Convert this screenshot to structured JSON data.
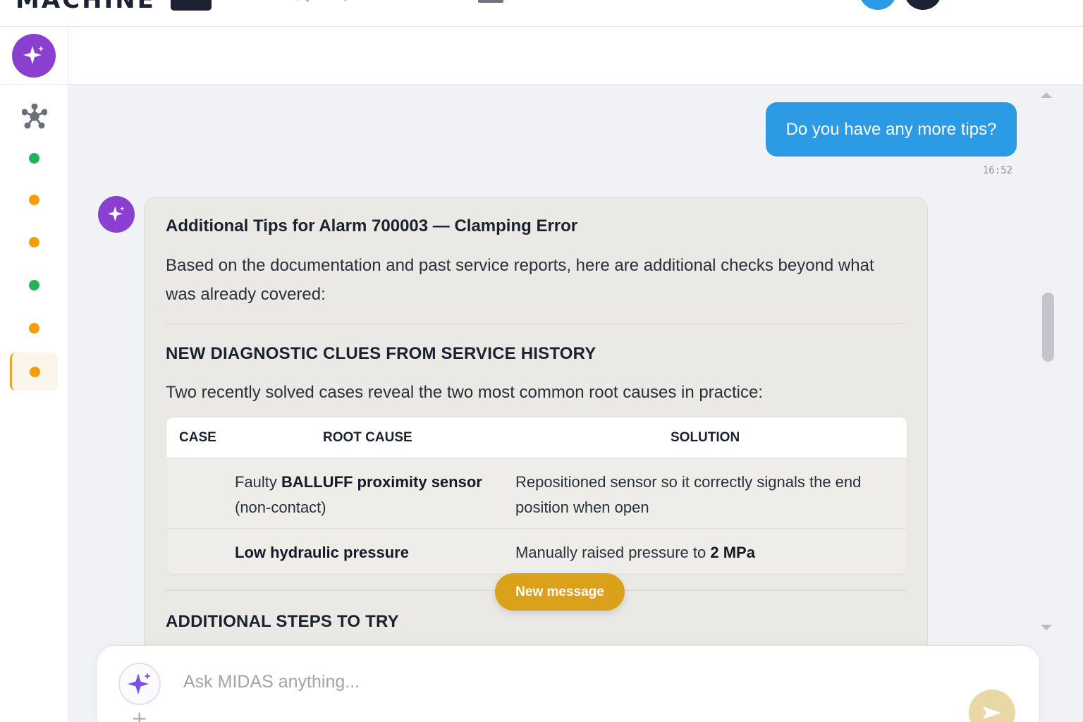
{
  "app": {
    "logo_text": "MACHINE"
  },
  "sidebar": {
    "items": [
      {
        "status": "green",
        "color": "#22b35a"
      },
      {
        "status": "orange",
        "color": "#f59e0b"
      },
      {
        "status": "orange",
        "color": "#f59e0b"
      },
      {
        "status": "green",
        "color": "#22b35a"
      },
      {
        "status": "orange",
        "color": "#f59e0b"
      },
      {
        "status": "orange",
        "color": "#f59e0b",
        "active": true
      }
    ]
  },
  "chat": {
    "user_message": "Do you have any more tips?",
    "user_timestamp": "16:52",
    "bot": {
      "title": "Additional Tips for Alarm 700003 — Clamping Error",
      "intro": "Based on the documentation and past service reports, here are additional checks beyond what was already covered:",
      "section1_heading": "NEW DIAGNOSTIC CLUES FROM SERVICE HISTORY",
      "section1_text": "Two recently solved cases reveal the two most common root causes in practice:",
      "table": {
        "headers": [
          "CASE",
          "ROOT CAUSE",
          "SOLUTION"
        ],
        "rows": [
          {
            "case": "",
            "root_cause_bold": "BALLUFF proximity sensor",
            "root_cause_prefix": "Faulty ",
            "root_cause_suffix": "(non-contact)",
            "solution": "Repositioned sensor so it correctly signals the end position when open"
          },
          {
            "case": "",
            "root_cause_bold": "Low hydraulic pressure",
            "solution_prefix": "Manually raised pressure to ",
            "solution_bold": "2 MPa"
          }
        ]
      },
      "section2_heading": "ADDITIONAL STEPS TO TRY"
    },
    "new_message_label": "New message"
  },
  "composer": {
    "placeholder": "Ask MIDAS anything...",
    "add_label": "+"
  },
  "colors": {
    "accent_purple": "#8a3fd1",
    "user_bubble": "#2b9be6",
    "new_message": "#dba11a",
    "send": "#e9d7a6"
  }
}
